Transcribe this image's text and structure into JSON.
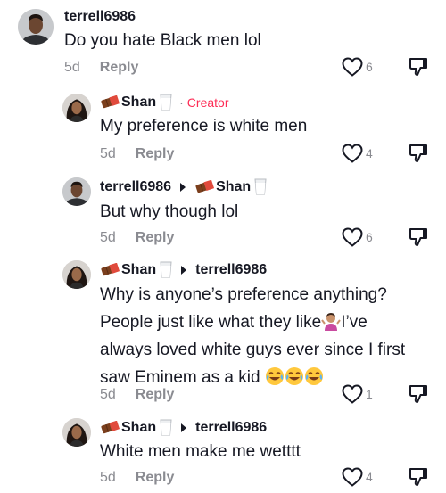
{
  "comments": [
    {
      "author": "terrell6986",
      "text": "Do you hate Black men lol",
      "time": "5d",
      "reply_label": "Reply",
      "likes": "6"
    },
    {
      "author": "Shan",
      "creator_label": "Creator",
      "text": "My preference is white men",
      "time": "5d",
      "reply_label": "Reply",
      "likes": "4"
    },
    {
      "author": "terrell6986",
      "reply_to": "Shan",
      "text": "But why though lol",
      "time": "5d",
      "reply_label": "Reply",
      "likes": "6"
    },
    {
      "author": "Shan",
      "reply_to": "terrell6986",
      "text_line1": "Why is anyone’s preference anything?",
      "text_line2a": "People just like what they like",
      "text_line2b": "I’ve",
      "text_line3": "always loved white guys ever since I first",
      "text_line4": "saw Eminem as a kid",
      "time": "5d",
      "reply_label": "Reply",
      "likes": "1"
    },
    {
      "author": "Shan",
      "reply_to": "terrell6986",
      "text": "White men make me wetttt",
      "time": "5d",
      "reply_label": "Reply",
      "likes": "4"
    }
  ],
  "icons": {
    "like": "heart-outline-icon",
    "dislike": "thumbs-down-outline-icon",
    "chocolate": "chocolate-bar-emoji",
    "milk": "glass-of-milk-emoji",
    "shrug": "woman-shrugging-emoji",
    "laugh": "tears-of-joy-emoji"
  },
  "colors": {
    "text": "#161823",
    "muted": "#8a8b91",
    "creator": "#fe2c55"
  }
}
